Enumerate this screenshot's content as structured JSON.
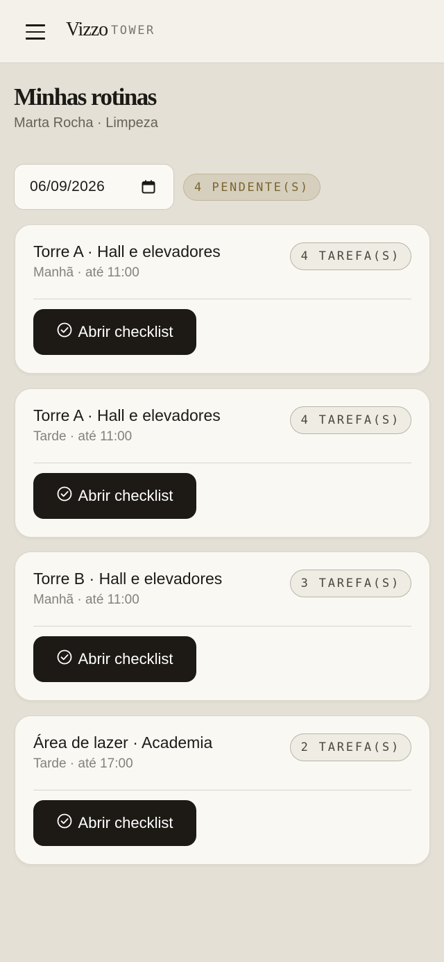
{
  "header": {
    "brand_name": "Vizzo",
    "brand_sub": "TOWER"
  },
  "page": {
    "title": "Minhas rotinas",
    "subtitle": "Marta Rocha · Limpeza"
  },
  "filters": {
    "date_value": "06/09/2026",
    "pending_label": "4 PENDENTE(S)"
  },
  "routines": [
    {
      "title": "Torre A · Hall e elevadores",
      "meta": "Manhã · até 11:00",
      "tasks_label": "4 TAREFA(S)",
      "button_label": "Abrir checklist"
    },
    {
      "title": "Torre A · Hall e elevadores",
      "meta": "Tarde · até 11:00",
      "tasks_label": "4 TAREFA(S)",
      "button_label": "Abrir checklist"
    },
    {
      "title": "Torre B · Hall e elevadores",
      "meta": "Manhã · até 11:00",
      "tasks_label": "3 TAREFA(S)",
      "button_label": "Abrir checklist"
    },
    {
      "title": "Área de lazer · Academia",
      "meta": "Tarde · até 17:00",
      "tasks_label": "2 TAREFA(S)",
      "button_label": "Abrir checklist"
    }
  ],
  "icons": {
    "menu": "menu-icon",
    "calendar": "calendar-icon",
    "check": "check-circle-icon"
  },
  "colors": {
    "background": "#e4e0d6",
    "card": "#f9f8f3",
    "button": "#1d1a16",
    "pending_badge_text": "#7b6530",
    "pending_badge_bg": "#d6cfbd"
  }
}
